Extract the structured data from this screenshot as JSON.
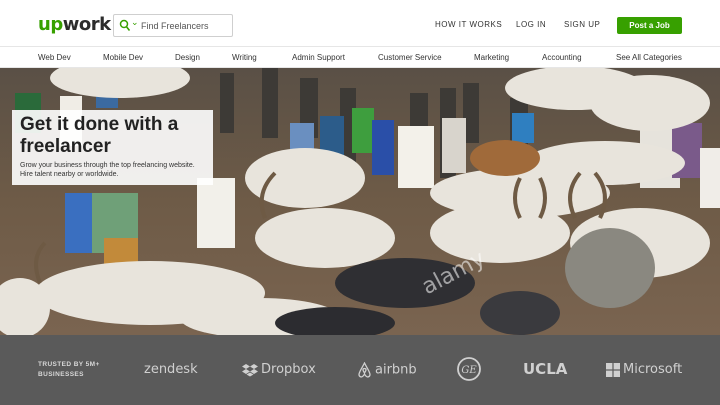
{
  "header": {
    "logo_prefix": "up",
    "logo_suffix": "work",
    "search_placeholder": "Find Freelancers",
    "nav": [
      "HOW IT WORKS",
      "LOG IN",
      "SIGN UP"
    ],
    "post_job_label": "Post a Job",
    "brand_color": "#37a000"
  },
  "categories": [
    "Web Dev",
    "Mobile Dev",
    "Design",
    "Writing",
    "Admin Support",
    "Customer Service",
    "Marketing",
    "Accounting",
    "See All Categories"
  ],
  "hero": {
    "title": "Get it done with a freelancer",
    "subtitle": "Grow your business through the top freelancing website. Hire talent nearby or worldwide.",
    "watermark": "alamy"
  },
  "trusted": {
    "label": "TRUSTED BY 5M+ BUSINESSES",
    "brands": [
      "zendesk",
      "Dropbox",
      "airbnb",
      "GE",
      "UCLA",
      "Microsoft"
    ],
    "brand_icons": [
      "",
      "dropbox-icon",
      "airbnb-icon",
      "ge-icon",
      "",
      "windows-icon"
    ]
  }
}
